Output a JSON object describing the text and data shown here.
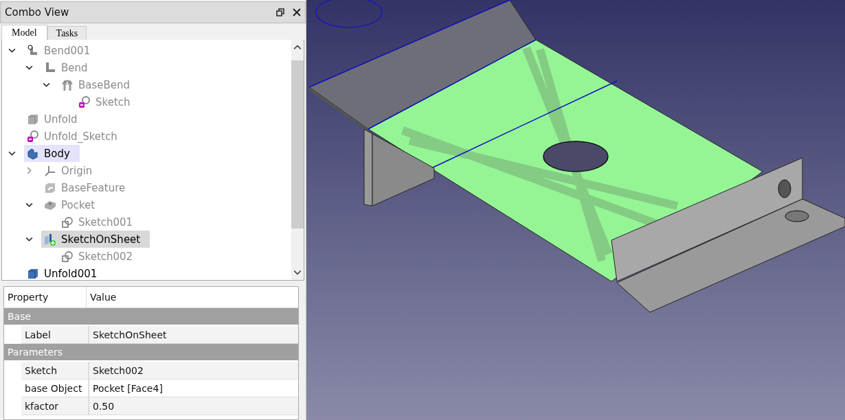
{
  "panel": {
    "title": "Combo View"
  },
  "tabs": [
    {
      "label": "Model",
      "selected": true
    },
    {
      "label": "Tasks",
      "selected": false
    }
  ],
  "tree": [
    {
      "label": "Bend001",
      "kind": "bend-tool",
      "dimmed": true,
      "selected": false,
      "current": false,
      "expanded": true,
      "children": [
        {
          "label": "Bend",
          "kind": "bend",
          "dimmed": true,
          "selected": false,
          "current": false,
          "expanded": true,
          "children": [
            {
              "label": "BaseBend",
              "kind": "base-bend",
              "dimmed": true,
              "selected": false,
              "current": false,
              "expanded": true,
              "children": [
                {
                  "label": "Sketch",
                  "kind": "sketch-locked",
                  "dimmed": true,
                  "selected": false,
                  "current": false
                }
              ]
            }
          ]
        }
      ]
    },
    {
      "label": "Unfold",
      "kind": "solid-grey",
      "dimmed": true,
      "selected": false,
      "current": false
    },
    {
      "label": "Unfold_Sketch",
      "kind": "sketch-locked",
      "dimmed": true,
      "selected": false,
      "current": false
    },
    {
      "label": "Body",
      "kind": "body",
      "dimmed": false,
      "selected": true,
      "current": false,
      "expanded": true,
      "children": [
        {
          "label": "Origin",
          "kind": "origin",
          "dimmed": true,
          "selected": false,
          "current": false,
          "expanded": false
        },
        {
          "label": "BaseFeature",
          "kind": "base-feature",
          "dimmed": true,
          "selected": false,
          "current": false
        },
        {
          "label": "Pocket",
          "kind": "pocket",
          "dimmed": true,
          "selected": false,
          "current": false,
          "expanded": true,
          "children": [
            {
              "label": "Sketch001",
              "kind": "sketch",
              "dimmed": true,
              "selected": false,
              "current": false
            }
          ]
        },
        {
          "label": "SketchOnSheet",
          "kind": "sketch-on-sheet",
          "dimmed": false,
          "selected": false,
          "current": true,
          "expanded": true,
          "children": [
            {
              "label": "Sketch002",
              "kind": "sketch",
              "dimmed": true,
              "selected": false,
              "current": false
            }
          ]
        }
      ]
    },
    {
      "label": "Unfold001",
      "kind": "solid-blue",
      "dimmed": false,
      "selected": false,
      "current": false
    }
  ],
  "properties": {
    "columns": [
      "Property",
      "Value"
    ],
    "groups": [
      {
        "name": "Base",
        "rows": [
          {
            "property": "Label",
            "value": "SketchOnSheet"
          }
        ]
      },
      {
        "name": "Parameters",
        "rows": [
          {
            "property": "Sketch",
            "value": "Sketch002"
          },
          {
            "property": "base Object",
            "value": "Pocket [Face4]"
          },
          {
            "property": "kfactor",
            "value": "0.50"
          }
        ]
      }
    ]
  }
}
